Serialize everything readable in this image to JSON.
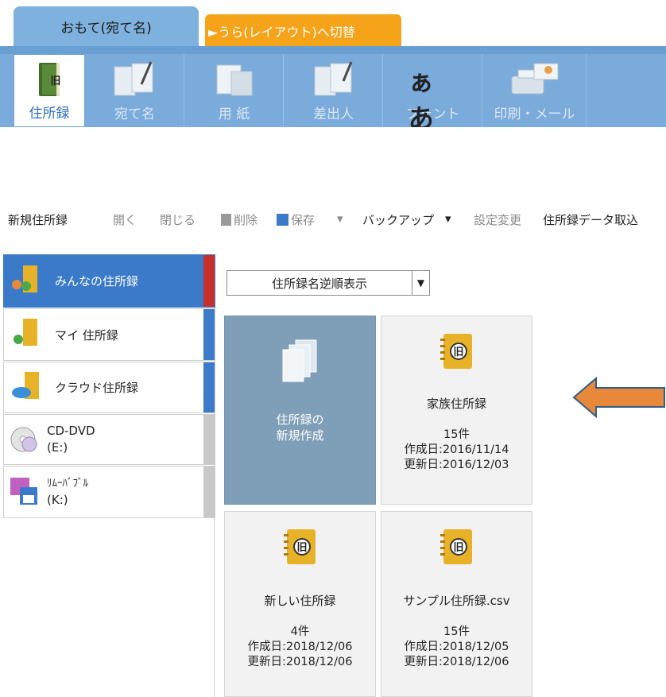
{
  "tabs": {
    "front": "おもて(宛て名)",
    "back": "►うら(レイアウト)へ切替"
  },
  "ribbon": {
    "items": [
      {
        "label": "住所録",
        "active": true
      },
      {
        "label": "宛て名",
        "active": false
      },
      {
        "label": "用 紙",
        "active": false
      },
      {
        "label": "差出人",
        "active": false
      },
      {
        "label": "フォント",
        "active": false
      },
      {
        "label": "印刷・メール",
        "active": false
      }
    ],
    "font_icon_text": "ぁあ"
  },
  "toolbar": {
    "new": "新規住所録",
    "open": "開く",
    "close": "閉じる",
    "delete": "削除",
    "save": "保存",
    "backup": "バックアップ",
    "settings": "設定変更",
    "import": "住所録データ取込"
  },
  "sidebar": {
    "items": [
      {
        "label": "みんなの住所録",
        "selected": true,
        "accent": "#c8302c"
      },
      {
        "label": "マイ 住所録",
        "selected": false,
        "accent": "#3a7ac8"
      },
      {
        "label": "クラウド住所録",
        "selected": false,
        "accent": "#3a7ac8"
      },
      {
        "label": "CD-DVD",
        "sub": "(E:)",
        "selected": false,
        "accent": "#c8c8c8"
      },
      {
        "label": "ﾘﾑｰﾊﾞﾌﾞﾙ",
        "sub": "(K:)",
        "selected": false,
        "accent": "#c8c8c8"
      }
    ]
  },
  "sort": {
    "value": "住所録名逆順表示"
  },
  "cards": {
    "new": {
      "line1": "住所録の",
      "line2": "新規作成"
    },
    "book1": {
      "name": "家族住所録",
      "count": "15件",
      "created": "作成日:2016/11/14",
      "updated": "更新日:2016/12/03"
    },
    "book2": {
      "name": "新しい住所録",
      "count": "4件",
      "created": "作成日:2018/12/06",
      "updated": "更新日:2018/12/06"
    },
    "book3": {
      "name": "サンプル住所録.csv",
      "count": "15件",
      "created": "作成日:2018/12/05",
      "updated": "更新日:2018/12/06"
    }
  },
  "book_icon_text": "旧",
  "colors": {
    "ribbon": "#7aabdb",
    "tab_back": "#f5a318",
    "selected": "#3a7ac8",
    "new_card": "#7f9fb8",
    "arrow": "#e8883a"
  }
}
